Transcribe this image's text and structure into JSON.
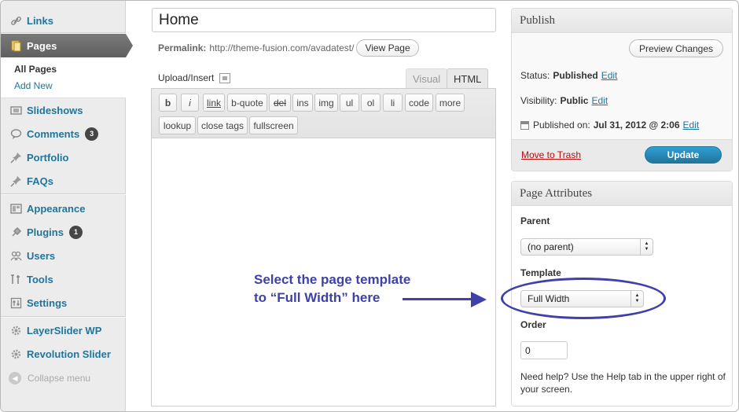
{
  "sidebar": {
    "items": [
      {
        "label": "Links",
        "icon": "link-icon"
      },
      {
        "label": "Pages",
        "icon": "pages-icon",
        "current": true
      },
      {
        "label": "Slideshows",
        "icon": "slideshows-icon"
      },
      {
        "label": "Comments",
        "icon": "comments-icon",
        "badge": "3"
      },
      {
        "label": "Portfolio",
        "icon": "pin-icon"
      },
      {
        "label": "FAQs",
        "icon": "pin-icon"
      },
      {
        "label": "Appearance",
        "icon": "appearance-icon"
      },
      {
        "label": "Plugins",
        "icon": "plugins-icon",
        "badge": "1"
      },
      {
        "label": "Users",
        "icon": "users-icon"
      },
      {
        "label": "Tools",
        "icon": "tools-icon"
      },
      {
        "label": "Settings",
        "icon": "settings-icon"
      },
      {
        "label": "LayerSlider WP",
        "icon": "gear-icon"
      },
      {
        "label": "Revolution Slider",
        "icon": "gear-icon"
      }
    ],
    "submenu": {
      "all_pages": "All Pages",
      "add_new": "Add New"
    },
    "collapse_label": "Collapse menu"
  },
  "editor": {
    "title_value": "Home",
    "permalink_label": "Permalink:",
    "permalink_url": "http://theme-fusion.com/avadatest/",
    "view_page": "View Page",
    "upload_insert": "Upload/Insert",
    "tab_visual": "Visual",
    "tab_html": "HTML",
    "quicktags_row1": [
      "b",
      "i",
      "link",
      "b-quote",
      "del",
      "ins",
      "img",
      "ul",
      "ol",
      "li",
      "code",
      "more"
    ],
    "quicktags_row2": [
      "lookup",
      "close tags",
      "fullscreen"
    ]
  },
  "annotation": {
    "line1": "Select the page template",
    "line2": "to “Full Width” here"
  },
  "publish": {
    "title": "Publish",
    "preview_changes": "Preview Changes",
    "status_label": "Status:",
    "status_value": "Published",
    "visibility_label": "Visibility:",
    "visibility_value": "Public",
    "published_on_label": "Published on:",
    "published_on_value": "Jul 31, 2012 @ 2:06",
    "edit": "Edit",
    "move_to_trash": "Move to Trash",
    "update": "Update"
  },
  "attributes": {
    "title": "Page Attributes",
    "parent_label": "Parent",
    "parent_value": "(no parent)",
    "template_label": "Template",
    "template_value": "Full Width",
    "order_label": "Order",
    "order_value": "0",
    "help_text": "Need help? Use the Help tab in the upper right of your screen."
  },
  "colors": {
    "link": "#21759b",
    "annotation": "#3f41a8",
    "trash": "#bc0b0b",
    "update_button": "#21759b"
  }
}
